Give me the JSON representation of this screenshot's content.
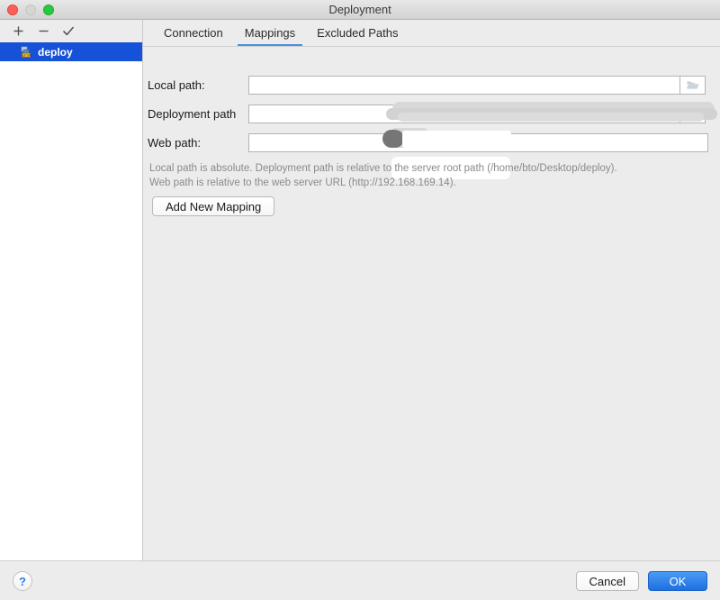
{
  "window": {
    "title": "Deployment",
    "traffic_lights": [
      {
        "name": "close",
        "color": "#ff5f57"
      },
      {
        "name": "minimize",
        "color": "#d6d6d6"
      },
      {
        "name": "maximize",
        "color": "#28c940"
      }
    ]
  },
  "sidebar": {
    "toolbar": [
      {
        "name": "add",
        "glyph": "+"
      },
      {
        "name": "remove",
        "glyph": "−"
      },
      {
        "name": "set-default",
        "glyph": "✓"
      }
    ],
    "items": [
      {
        "label": "deploy",
        "icon": "sftp-server-icon",
        "selected": true
      }
    ]
  },
  "tabs": [
    {
      "label": "Connection",
      "active": false
    },
    {
      "label": "Mappings",
      "active": true
    },
    {
      "label": "Excluded Paths",
      "active": false
    }
  ],
  "form": {
    "fields": [
      {
        "label": "Local path:",
        "value": "",
        "has_browse": true
      },
      {
        "label": "Deployment path",
        "value": "",
        "has_browse": true
      },
      {
        "label": "Web path:",
        "value": "",
        "has_browse": false
      }
    ],
    "hint_line_1": "Local path is absolute. Deployment path is relative to the server root path (/home/bto/Desktop/deploy).",
    "hint_line_2": "Web path is relative to the web server URL (http://192.168.169.14).",
    "add_mapping_label": "Add New Mapping"
  },
  "footer": {
    "help_label": "?",
    "cancel_label": "Cancel",
    "ok_label": "OK"
  },
  "colors": {
    "accent_blue": "#1552d8",
    "tab_underline": "#4a8fe0",
    "default_button": "#1f6fe0",
    "hint_text": "#8a8a8a"
  }
}
